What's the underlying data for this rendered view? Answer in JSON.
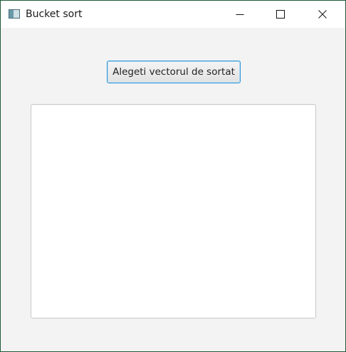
{
  "window": {
    "title": "Bucket sort",
    "controls": {
      "minimize_icon": "minimize-icon",
      "maximize_icon": "maximize-icon",
      "close_icon": "close-icon"
    }
  },
  "main": {
    "action_button_label": "Alegeti vectorul de sortat",
    "output_text": ""
  },
  "colors": {
    "window_background": "#f3f3f3",
    "titlebar_background": "#ffffff",
    "button_focus_border": "#2a94d6",
    "desktop_border": "#1f5a3a"
  }
}
